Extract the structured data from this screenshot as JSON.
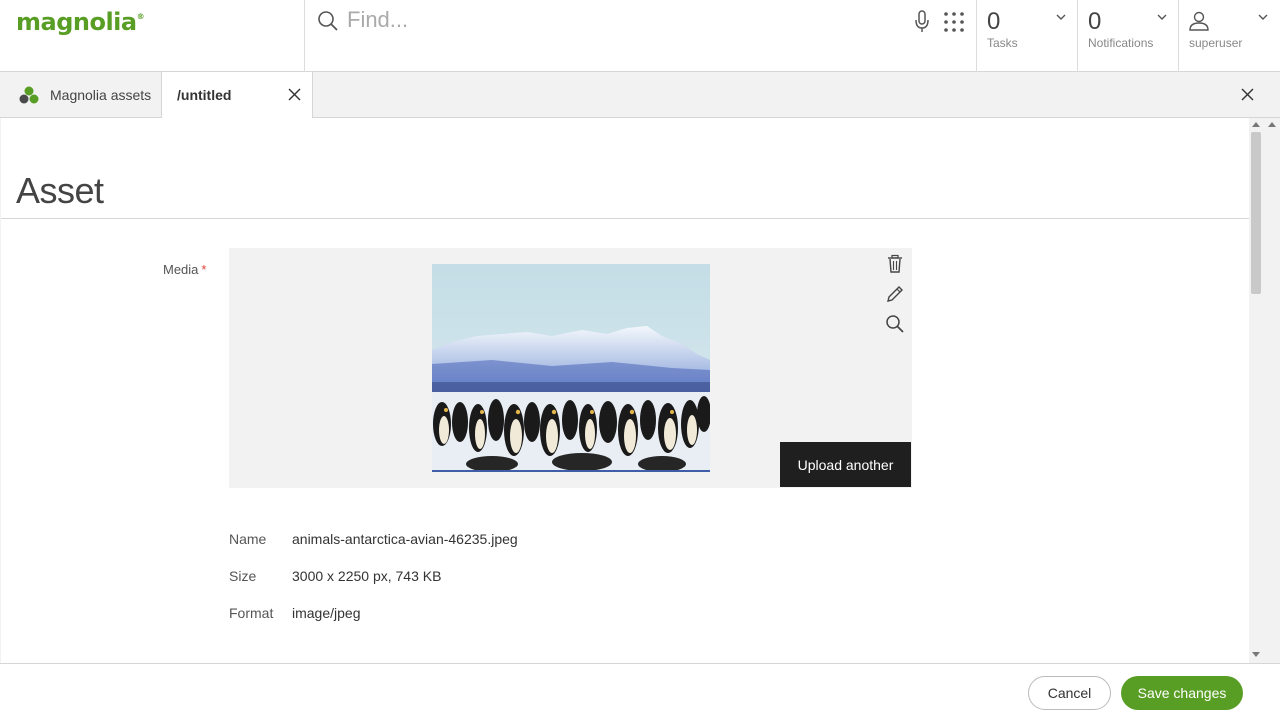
{
  "header": {
    "logo": {
      "text": "magnolia",
      "mark": "®"
    },
    "search": {
      "placeholder": "Find..."
    },
    "tasks": {
      "count": "0",
      "label": "Tasks"
    },
    "notifications": {
      "count": "0",
      "label": "Notifications"
    },
    "user": {
      "name": "superuser"
    },
    "icons": [
      "search-icon",
      "microphone-icon",
      "app-launcher-icon",
      "chevron-down-icon",
      "user-icon"
    ]
  },
  "tabs": {
    "app_tab_label": "Magnolia assets",
    "doc_tab_label": "/untitled"
  },
  "form": {
    "title": "Asset",
    "media_label": "Media",
    "required_mark": "*",
    "upload_label": "Upload another",
    "photo_subject": "Emperor penguins in front of snowy Antarctic mountains",
    "meta": [
      {
        "key": "Name",
        "value": "animals-antarctica-avian-46235.jpeg"
      },
      {
        "key": "Size",
        "value": "3000 x 2250 px, 743 KB"
      },
      {
        "key": "Format",
        "value": "image/jpeg"
      }
    ]
  },
  "footer": {
    "cancel_label": "Cancel",
    "save_label": "Save changes"
  },
  "colors": {
    "brand": "#599e24",
    "dark_button": "#1f1f1f",
    "required": "#e0423b"
  }
}
